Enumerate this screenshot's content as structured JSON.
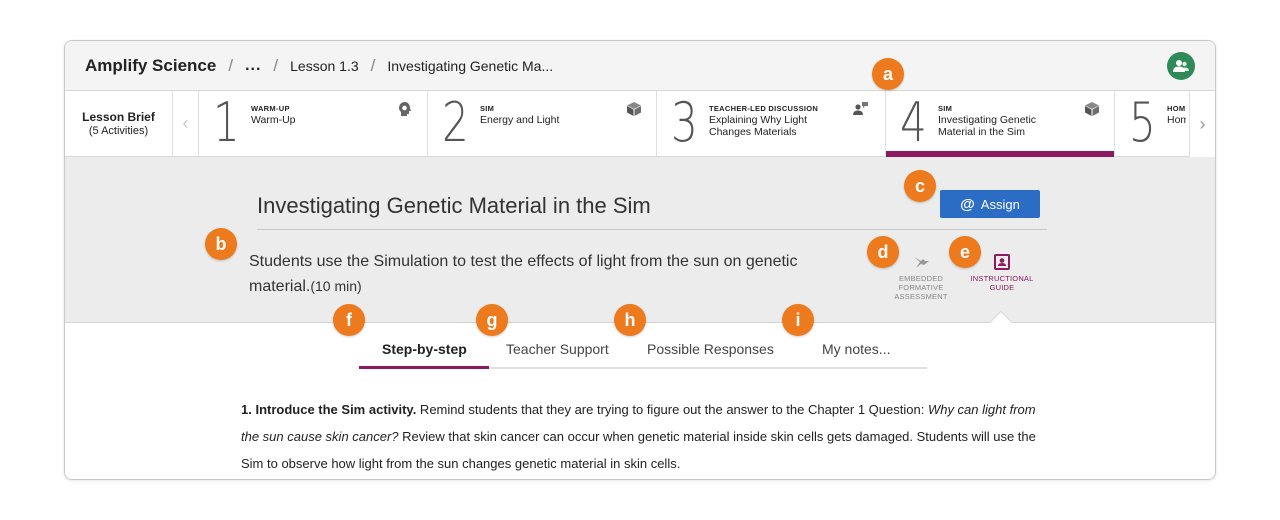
{
  "breadcrumb": {
    "app": "Amplify Science",
    "ellipsis": "...",
    "lesson": "Lesson 1.3",
    "current": "Investigating Genetic Ma..."
  },
  "lesson_brief": {
    "line1": "Lesson Brief",
    "line2": "(5 Activities)"
  },
  "activities": [
    {
      "number": "1",
      "type": "WARM-UP",
      "title": "Warm-Up",
      "icon": "head-icon"
    },
    {
      "number": "2",
      "type": "SIM",
      "title": "Energy and Light",
      "icon": "cube-icon"
    },
    {
      "number": "3",
      "type": "TEACHER-LED DISCUSSION",
      "title": "Explaining Why Light Changes Materials",
      "icon": "discussion-icon"
    },
    {
      "number": "4",
      "type": "SIM",
      "title": "Investigating Genetic Material in the Sim",
      "icon": "cube-icon",
      "selected": true
    },
    {
      "number": "5",
      "type": "HOM",
      "title": "Hom"
    }
  ],
  "activity": {
    "title": "Investigating Genetic Material in the Sim",
    "description": "Students use the Simulation to test the effects of light from the sun on genetic material.",
    "duration": "(10 min)",
    "assign_label": "Assign",
    "assign_symbol": "@"
  },
  "tools": {
    "efa_line1": "EMBEDDED",
    "efa_line2": "FORMATIVE",
    "efa_line3": "ASSESSMENT",
    "ig_line1": "INSTRUCTIONAL",
    "ig_line2": "GUIDE"
  },
  "tabs": [
    "Step-by-step",
    "Teacher Support",
    "Possible Responses",
    "My notes..."
  ],
  "content": {
    "step_bold": "1. Introduce the Sim activity.",
    "text1": " Remind students that they are trying to figure out the answer to the Chapter 1 Question: ",
    "italic1": "Why can light from the sun cause skin cancer?",
    "text2": " Review that skin cancer can occur when genetic material inside skin cells gets damaged. Students will use the Sim to observe how light from the sun changes genetic material in skin cells."
  },
  "callouts": [
    "a",
    "b",
    "c",
    "d",
    "e",
    "f",
    "g",
    "h",
    "i"
  ],
  "colors": {
    "accent": "#8b1a5e",
    "assign": "#2b6cc4",
    "callout": "#ed7a1d",
    "avatar": "#2e8b57"
  }
}
